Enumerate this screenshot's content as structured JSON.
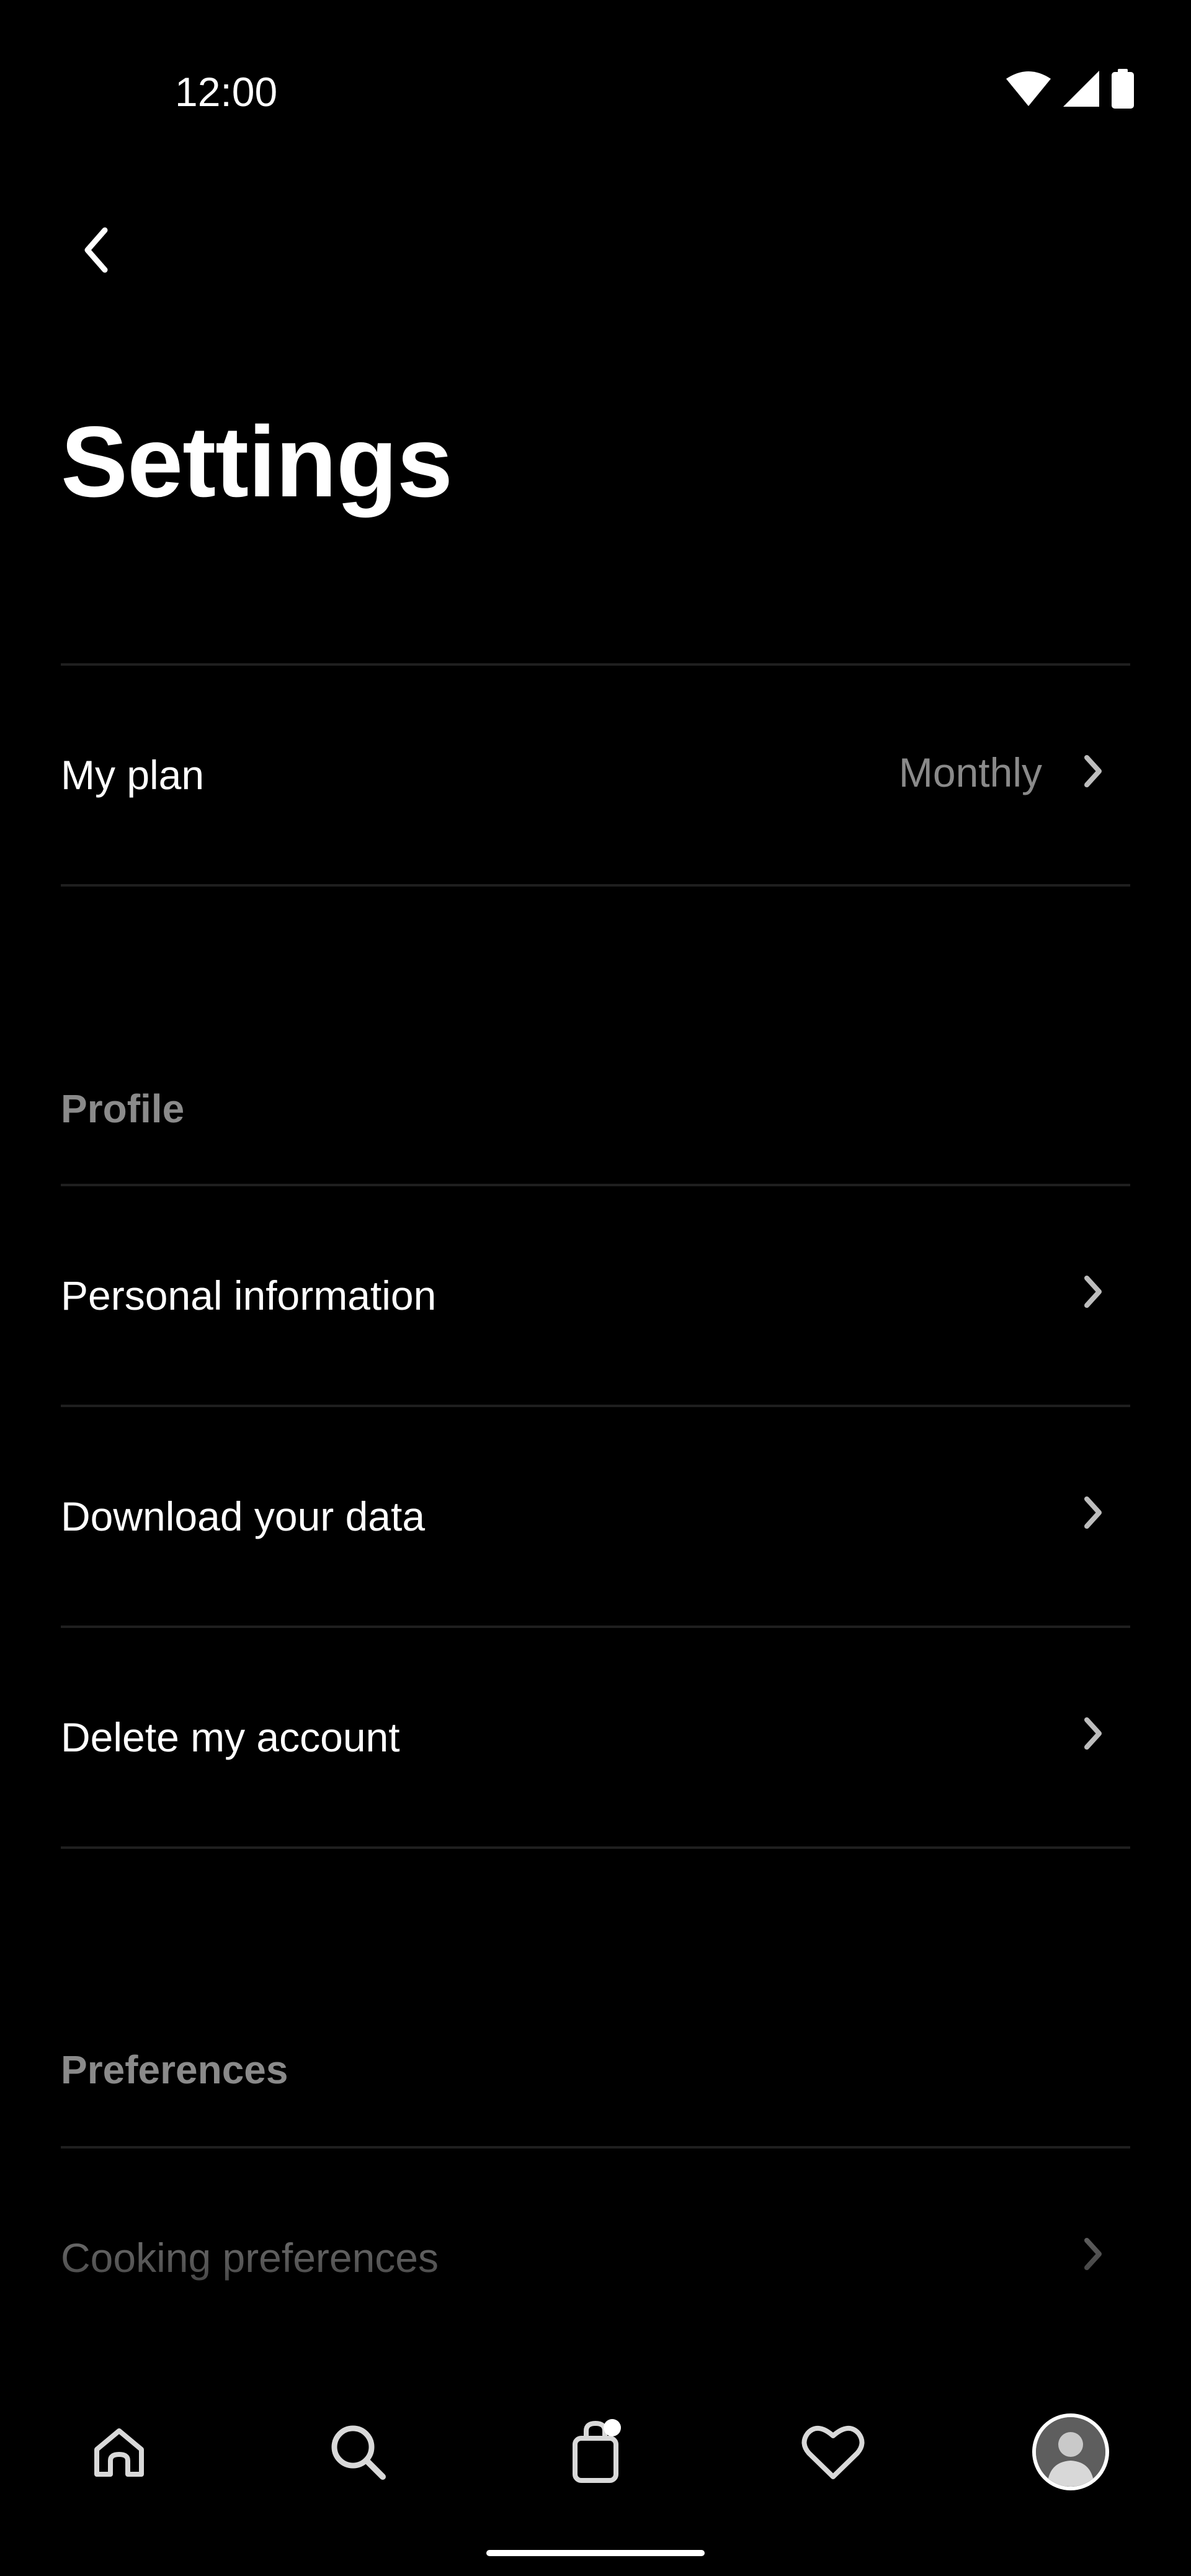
{
  "status_bar": {
    "time": "12:00",
    "icons": [
      "wifi-icon",
      "signal-icon",
      "battery-icon"
    ]
  },
  "header": {
    "back_icon": "chevron-left-icon",
    "title": "Settings"
  },
  "plan": {
    "label": "My plan",
    "value": "Monthly"
  },
  "sections": [
    {
      "title": "Profile",
      "items": [
        {
          "label": "Personal information"
        },
        {
          "label": "Download your data"
        },
        {
          "label": "Delete my account"
        }
      ]
    },
    {
      "title": "Preferences",
      "items": [
        {
          "label": "Cooking preferences"
        }
      ]
    }
  ],
  "bottom_nav": {
    "items": [
      "home-icon",
      "search-icon",
      "shopping-bag-icon",
      "heart-icon",
      "profile-avatar"
    ],
    "cart_has_badge": true
  },
  "colors": {
    "background": "#000000",
    "text_primary": "#ffffff",
    "text_secondary": "#8a8a8a",
    "divider": "#1f1f1f"
  }
}
